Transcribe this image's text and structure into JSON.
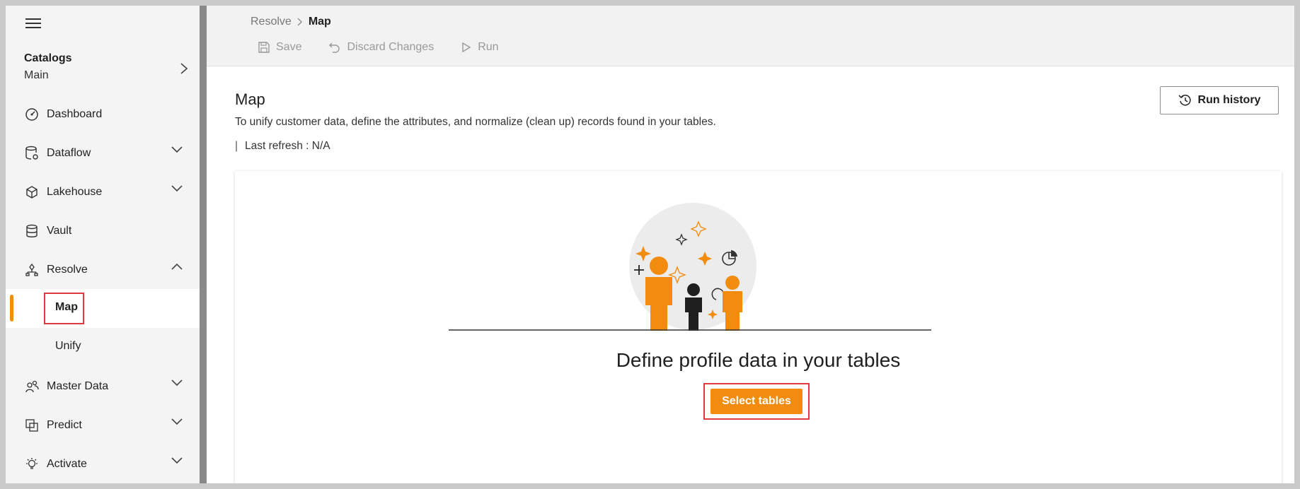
{
  "sidebar": {
    "catalog_title": "Catalogs",
    "catalog_value": "Main",
    "items": [
      {
        "label": "Dashboard"
      },
      {
        "label": "Dataflow"
      },
      {
        "label": "Lakehouse"
      },
      {
        "label": "Vault"
      },
      {
        "label": "Resolve"
      },
      {
        "label": "Map"
      },
      {
        "label": "Unify"
      },
      {
        "label": "Master Data"
      },
      {
        "label": "Predict"
      },
      {
        "label": "Activate"
      }
    ]
  },
  "breadcrumb": {
    "parent": "Resolve",
    "current": "Map"
  },
  "toolbar": {
    "save": "Save",
    "discard": "Discard Changes",
    "run": "Run"
  },
  "page": {
    "title": "Map",
    "description": "To unify customer data, define the attributes, and normalize (clean up) records found in your tables.",
    "refresh_sep": "|",
    "refresh": "Last refresh : N/A",
    "run_history": "Run history"
  },
  "empty_state": {
    "title": "Define profile data in your tables",
    "button": "Select tables"
  },
  "colors": {
    "accent": "#f28c0f",
    "highlight": "#e0393e"
  }
}
